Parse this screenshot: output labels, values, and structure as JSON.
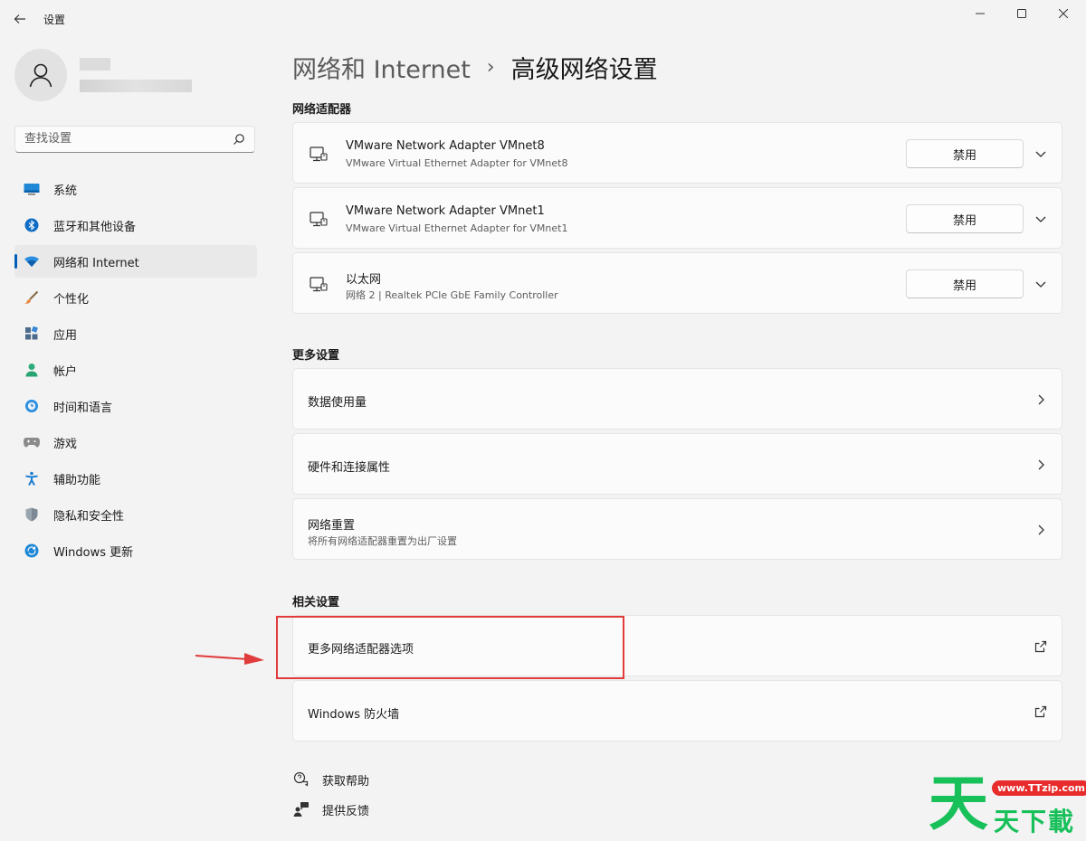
{
  "window": {
    "title": "设置"
  },
  "search": {
    "placeholder": "查找设置"
  },
  "sidebar": {
    "items": [
      {
        "label": "系统",
        "icon": "monitor-icon",
        "active": false
      },
      {
        "label": "蓝牙和其他设备",
        "icon": "bluetooth-icon",
        "active": false
      },
      {
        "label": "网络和 Internet",
        "icon": "wifi-icon",
        "active": true
      },
      {
        "label": "个性化",
        "icon": "brush-icon",
        "active": false
      },
      {
        "label": "应用",
        "icon": "apps-icon",
        "active": false
      },
      {
        "label": "帐户",
        "icon": "person-icon",
        "active": false
      },
      {
        "label": "时间和语言",
        "icon": "globe-clock-icon",
        "active": false
      },
      {
        "label": "游戏",
        "icon": "gamepad-icon",
        "active": false
      },
      {
        "label": "辅助功能",
        "icon": "accessibility-icon",
        "active": false
      },
      {
        "label": "隐私和安全性",
        "icon": "shield-icon",
        "active": false
      },
      {
        "label": "Windows 更新",
        "icon": "update-icon",
        "active": false
      }
    ]
  },
  "breadcrumb": {
    "parent": "网络和 Internet",
    "separator": "›",
    "current": "高级网络设置"
  },
  "adapters": {
    "title": "网络适配器",
    "disable_label": "禁用",
    "items": [
      {
        "name": "VMware Network Adapter VMnet8",
        "desc": "VMware Virtual Ethernet Adapter for VMnet8"
      },
      {
        "name": "VMware Network Adapter VMnet1",
        "desc": "VMware Virtual Ethernet Adapter for VMnet1"
      },
      {
        "name": "以太网",
        "desc": "网络 2 | Realtek PCIe GbE Family Controller"
      }
    ]
  },
  "more_settings": {
    "title": "更多设置",
    "items": [
      {
        "label": "数据使用量",
        "desc": ""
      },
      {
        "label": "硬件和连接属性",
        "desc": ""
      },
      {
        "label": "网络重置",
        "desc": "将所有网络适配器重置为出厂设置"
      }
    ]
  },
  "related": {
    "title": "相关设置",
    "items": [
      {
        "label": "更多网络适配器选项"
      },
      {
        "label": "Windows 防火墙"
      }
    ]
  },
  "help": {
    "get_help": "获取帮助",
    "feedback": "提供反馈"
  },
  "watermark": {
    "big_char": "天",
    "url": "www.TTzip.com",
    "text": "天下載"
  },
  "colors": {
    "accent": "#005fb8",
    "annotation": "#e03c3c",
    "watermark_green": "#18c05a"
  }
}
